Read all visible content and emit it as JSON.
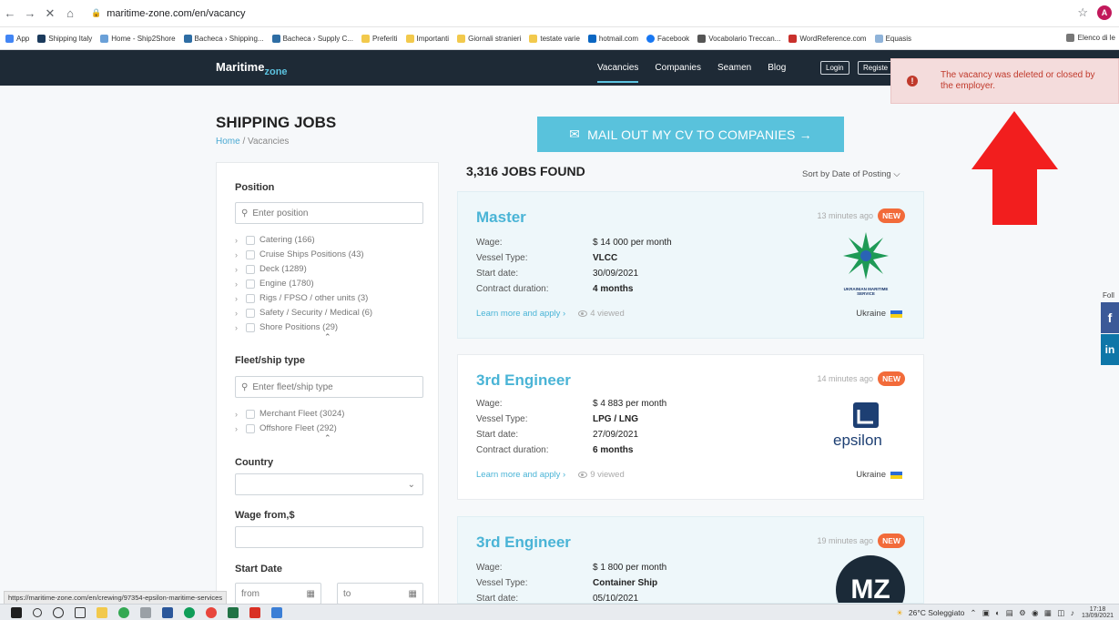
{
  "browser": {
    "url": "maritime-zone.com/en/vacancy",
    "profile_initial": "A",
    "bookmarks": [
      "App",
      "Shipping Italy",
      "Home - Ship2Shore",
      "Bacheca › Shipping...",
      "Bacheca › Supply C...",
      "Preferiti",
      "Importanti",
      "Giornali stranieri",
      "testate varie",
      "hotmail.com",
      "Facebook",
      "Vocabolario Treccan...",
      "WordReference.com",
      "Equasis"
    ],
    "bookmarks_right": "Elenco di le"
  },
  "site": {
    "logo_main": "Maritime",
    "logo_sub": "zone",
    "nav": [
      "Vacancies",
      "Companies",
      "Seamen",
      "Blog"
    ],
    "login": "Login",
    "register": "Registe"
  },
  "alert": {
    "text": "The vacancy was deleted or closed by the employer."
  },
  "page": {
    "title": "SHIPPING JOBS",
    "breadcrumb_home": "Home",
    "breadcrumb_sep": "/",
    "breadcrumb_current": "Vacancies",
    "cv_button": "MAIL OUT MY CV TO COMPANIES →"
  },
  "filters": {
    "position_heading": "Position",
    "position_placeholder": "Enter position",
    "position_options": [
      "Catering (166)",
      "Cruise Ships Positions (43)",
      "Deck (1289)",
      "Engine (1780)",
      "Rigs / FPSO / other units (3)",
      "Safety / Security / Medical (6)",
      "Shore Positions (29)"
    ],
    "fleet_heading": "Fleet/ship type",
    "fleet_placeholder": "Enter fleet/ship type",
    "fleet_options": [
      "Merchant Fleet (3024)",
      "Offshore Fleet (292)"
    ],
    "country_heading": "Country",
    "wage_heading": "Wage from,$",
    "start_heading": "Start Date",
    "from_placeholder": "from",
    "to_placeholder": "to"
  },
  "results": {
    "count": "3,316 JOBS FOUND",
    "sort": "Sort by Date of Posting ⌵",
    "labels": {
      "wage": "Wage:",
      "vessel": "Vessel Type:",
      "start": "Start date:",
      "duration": "Contract duration:",
      "learn": "Learn more and apply ›",
      "new": "NEW"
    },
    "jobs": [
      {
        "title": "Master",
        "time": "13 minutes ago",
        "wage": "$ 14 000 per month",
        "vessel": "VLCC",
        "start": "30/09/2021",
        "duration": "4 months",
        "views": "4 viewed",
        "country": "Ukraine",
        "logo_text": "UKRAINIAN MARITIME SERVICE"
      },
      {
        "title": "3rd Engineer",
        "time": "14 minutes ago",
        "wage": "$ 4 883 per month",
        "vessel": "LPG / LNG",
        "start": "27/09/2021",
        "duration": "6 months",
        "views": "9 viewed",
        "country": "Ukraine",
        "logo_text": "epsilon"
      },
      {
        "title": "3rd Engineer",
        "time": "19 minutes ago",
        "wage": "$ 1 800 per month",
        "vessel": "Container Ship",
        "start": "05/10/2021",
        "logo_text": "MZ"
      }
    ]
  },
  "social": {
    "follow": "Foll",
    "fb": "f",
    "li": "in"
  },
  "status_url": "https://maritime-zone.com/en/crewing/97354-epsilon-maritime-services",
  "taskbar": {
    "weather": "26°C Soleggiato",
    "time": "17:18",
    "date": "13/09/2021"
  },
  "colors": {
    "accent": "#4ab4d6",
    "header": "#1e2a36",
    "new_badge": "#f26b3a",
    "alert_text": "#c0392b"
  }
}
